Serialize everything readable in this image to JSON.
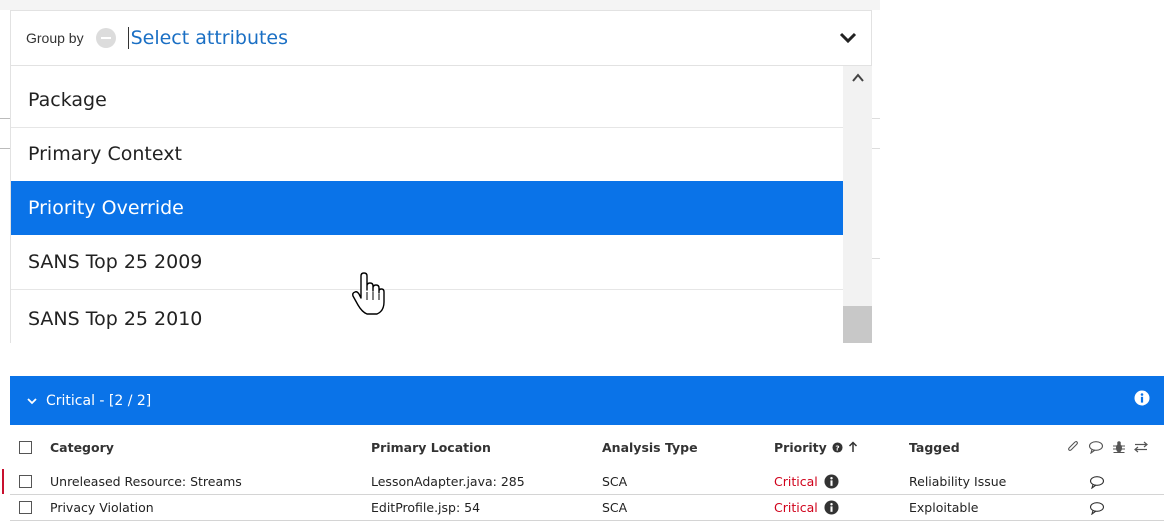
{
  "groupby": {
    "label": "Group by",
    "placeholder": "Select attributes",
    "options": [
      {
        "label": "Package",
        "selected": false
      },
      {
        "label": "Primary Context",
        "selected": false
      },
      {
        "label": "Priority Override",
        "selected": true
      },
      {
        "label": "SANS Top 25 2009",
        "selected": false
      },
      {
        "label": "SANS Top 25 2010",
        "selected": false
      }
    ]
  },
  "issues": {
    "group_title": "Critical - [2 / 2]",
    "columns": {
      "category": "Category",
      "primary_location": "Primary Location",
      "analysis_type": "Analysis Type",
      "priority": "Priority",
      "tagged": "Tagged"
    },
    "rows": [
      {
        "category": "Unreleased Resource: Streams",
        "primary_location": "LessonAdapter.java: 285",
        "analysis_type": "SCA",
        "priority": "Critical",
        "tagged": "Reliability Issue"
      },
      {
        "category": "Privacy Violation",
        "primary_location": "EditProfile.jsp: 54",
        "analysis_type": "SCA",
        "priority": "Critical",
        "tagged": "Exploitable"
      }
    ]
  },
  "colors": {
    "accent": "#0a73e8",
    "critical": "#d0021b",
    "link_text": "#1a6fc4"
  },
  "icons": [
    "chevron-down-icon",
    "scroll-up-icon",
    "hand-cursor-icon",
    "info-icon",
    "help-icon",
    "sort-up-icon",
    "paperclip-icon",
    "comment-icon",
    "bug-icon",
    "swap-icon"
  ]
}
